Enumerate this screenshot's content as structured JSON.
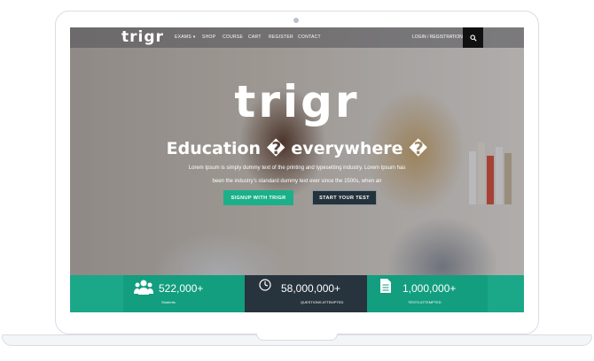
{
  "brand": {
    "logo": "trigr"
  },
  "nav": {
    "items": [
      "EXAMS ▾",
      "SHOP",
      "COURSE",
      "CART",
      "REGISTER",
      "CONTACT"
    ],
    "login": "LOGIN / REGISTRATION"
  },
  "hero": {
    "logo": "trigr",
    "headline": "Education � everywhere �",
    "sub_line_1": "Lorem Ipsum is simply dummy text of the printing and typesetting industry. Lorem Ipsum has",
    "sub_line_2": "been the industry's standard dummy text ever since the 1500s, when an",
    "signup_label": "SIGNUP WITH TRIGR",
    "test_label": "START YOUR TEST"
  },
  "stats": [
    {
      "value": "522,000+",
      "label": "Students",
      "icon": "users-icon"
    },
    {
      "value": "58,000,000+",
      "label": "QUESTIONS ATTEMPTED",
      "icon": "clock-icon"
    },
    {
      "value": "1,000,000+",
      "label": "TESTS ATTEMPTED",
      "icon": "document-icon"
    }
  ],
  "colors": {
    "accent": "#1bb08a",
    "dark": "#27333d",
    "stat_green": "#129e7f"
  }
}
